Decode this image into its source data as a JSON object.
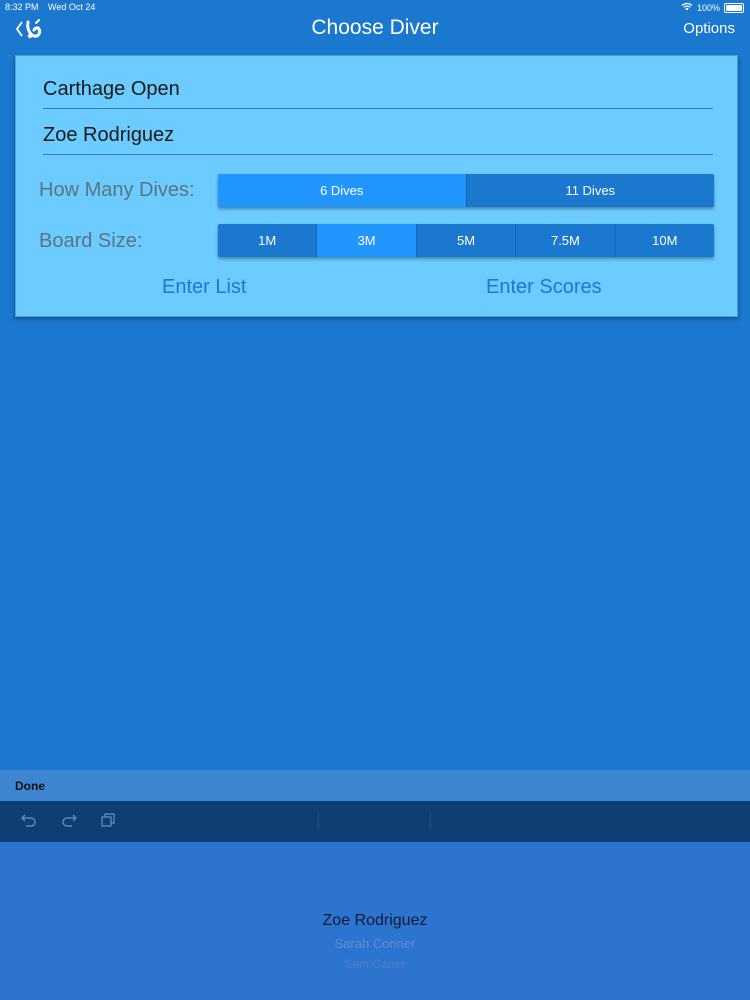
{
  "status_bar": {
    "time": "8:32 PM",
    "date": "Wed Oct 24",
    "battery": "100%"
  },
  "nav": {
    "title": "Choose Diver",
    "options_label": "Options",
    "back_icon": "diver-logo-back-icon"
  },
  "form": {
    "meet_name": "Carthage Open",
    "diver_name": "Zoe Rodriguez",
    "dives_label": "How Many Dives:",
    "dives_options": [
      "6 Dives",
      "11 Dives"
    ],
    "dives_selected": "6 Dives",
    "board_label": "Board Size:",
    "board_options": [
      "1M",
      "3M",
      "5M",
      "7.5M",
      "10M"
    ],
    "board_selected": "3M",
    "enter_list_label": "Enter List",
    "enter_scores_label": "Enter Scores"
  },
  "keyboard": {
    "done_label": "Done",
    "icons": [
      "undo-icon",
      "redo-icon",
      "paste-icon"
    ]
  },
  "picker": {
    "items": [
      "Zoe Rodriguez",
      "Sarah Conner",
      "Sam Carter"
    ],
    "selected": "Zoe Rodriguez"
  },
  "colors": {
    "background": "#1a78cf",
    "card": "#6ccbff",
    "selected_segment": "#2196ff",
    "link": "#1a78cf"
  }
}
